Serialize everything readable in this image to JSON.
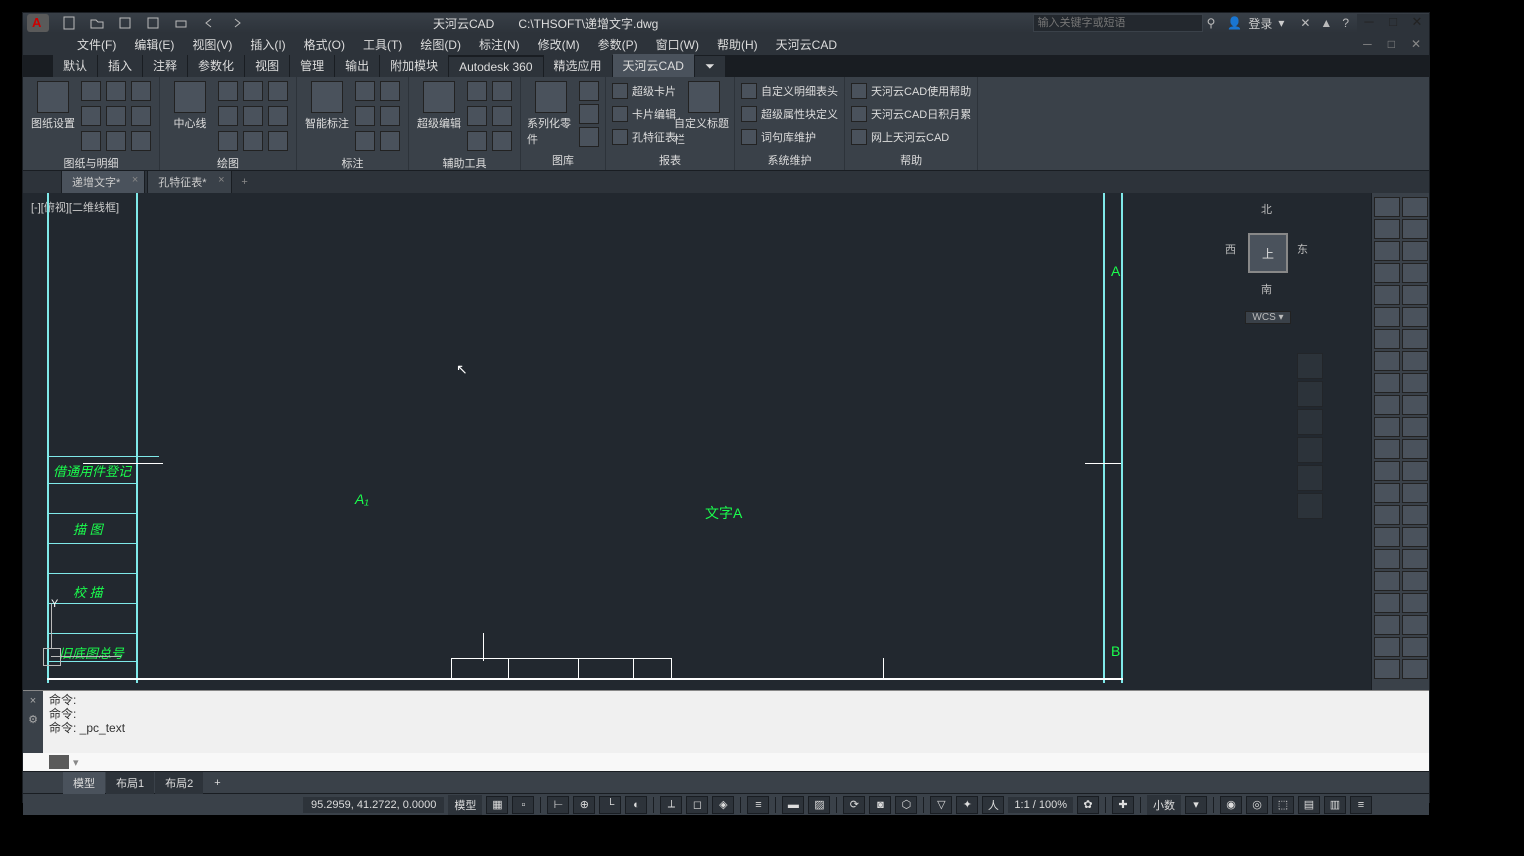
{
  "colors": {
    "bg": "#22282f",
    "panel": "#3a4149",
    "accent_green": "#1aff4d",
    "accent_cyan": "#7fe9e9"
  },
  "titlebar": {
    "app_title": "天河云CAD",
    "file_path": "C:\\THSOFT\\递增文字.dwg",
    "search_placeholder": "输入关键字或短语",
    "login_label": "登录"
  },
  "qat_icons": [
    "new",
    "open",
    "save",
    "saveas",
    "print",
    "undo",
    "redo"
  ],
  "menubar": [
    "文件(F)",
    "编辑(E)",
    "视图(V)",
    "插入(I)",
    "格式(O)",
    "工具(T)",
    "绘图(D)",
    "标注(N)",
    "修改(M)",
    "参数(P)",
    "窗口(W)",
    "帮助(H)",
    "天河云CAD"
  ],
  "ribbon_tabs": [
    "默认",
    "插入",
    "注释",
    "参数化",
    "视图",
    "管理",
    "输出",
    "附加模块",
    "Autodesk 360",
    "精选应用",
    "天河云CAD"
  ],
  "active_ribbon_tab": "天河云CAD",
  "ribbon_panels": {
    "p1": {
      "big": [
        "图纸设置"
      ],
      "label": "图纸与明细"
    },
    "p2": {
      "big": [
        "中心线"
      ],
      "label": "绘图"
    },
    "p3": {
      "big": [
        "智能标注"
      ],
      "label": "标注"
    },
    "p4": {
      "big": [
        "超级编辑"
      ],
      "label": "辅助工具"
    },
    "p5": {
      "big": [
        "系列化零件"
      ],
      "label": "图库"
    },
    "p6": {
      "big": [
        "超级卡片",
        "卡片编辑",
        "孔特征表"
      ],
      "big2": "自定义标题栏",
      "label": "报表"
    },
    "p7": {
      "links": [
        "自定义明细表头",
        "超级属性块定义",
        "词句库维护"
      ],
      "label": "系统维护"
    },
    "p8": {
      "links": [
        "天河云CAD使用帮助",
        "天河云CAD日积月累",
        "网上天河云CAD"
      ],
      "label": "帮助"
    }
  },
  "dwg_tabs": [
    {
      "title": "递增文字*",
      "active": true
    },
    {
      "title": "孔特征表*",
      "active": false
    }
  ],
  "viewport_label": "[-][俯视][二维线框]",
  "drawing_texts": {
    "A1": "A₁",
    "text_a": "文字A",
    "A": "A",
    "B": "B",
    "left_1": "借通用件登记",
    "left_2": "描    图",
    "left_3": "校    描",
    "left_4": "旧底图总号",
    "ucs_y": "Y"
  },
  "viewcube": {
    "north": "北",
    "south": "南",
    "east": "东",
    "west": "西",
    "top": "上",
    "wcs": "WCS"
  },
  "command_lines": [
    "命令:",
    "命令:",
    "命令: _pc_text"
  ],
  "layout_tabs": [
    "模型",
    "布局1",
    "布局2"
  ],
  "statusbar": {
    "coords": "95.2959, 41.2722, 0.0000",
    "space": "模型",
    "zoom": "1:1 / 100%",
    "deci": "小数"
  }
}
